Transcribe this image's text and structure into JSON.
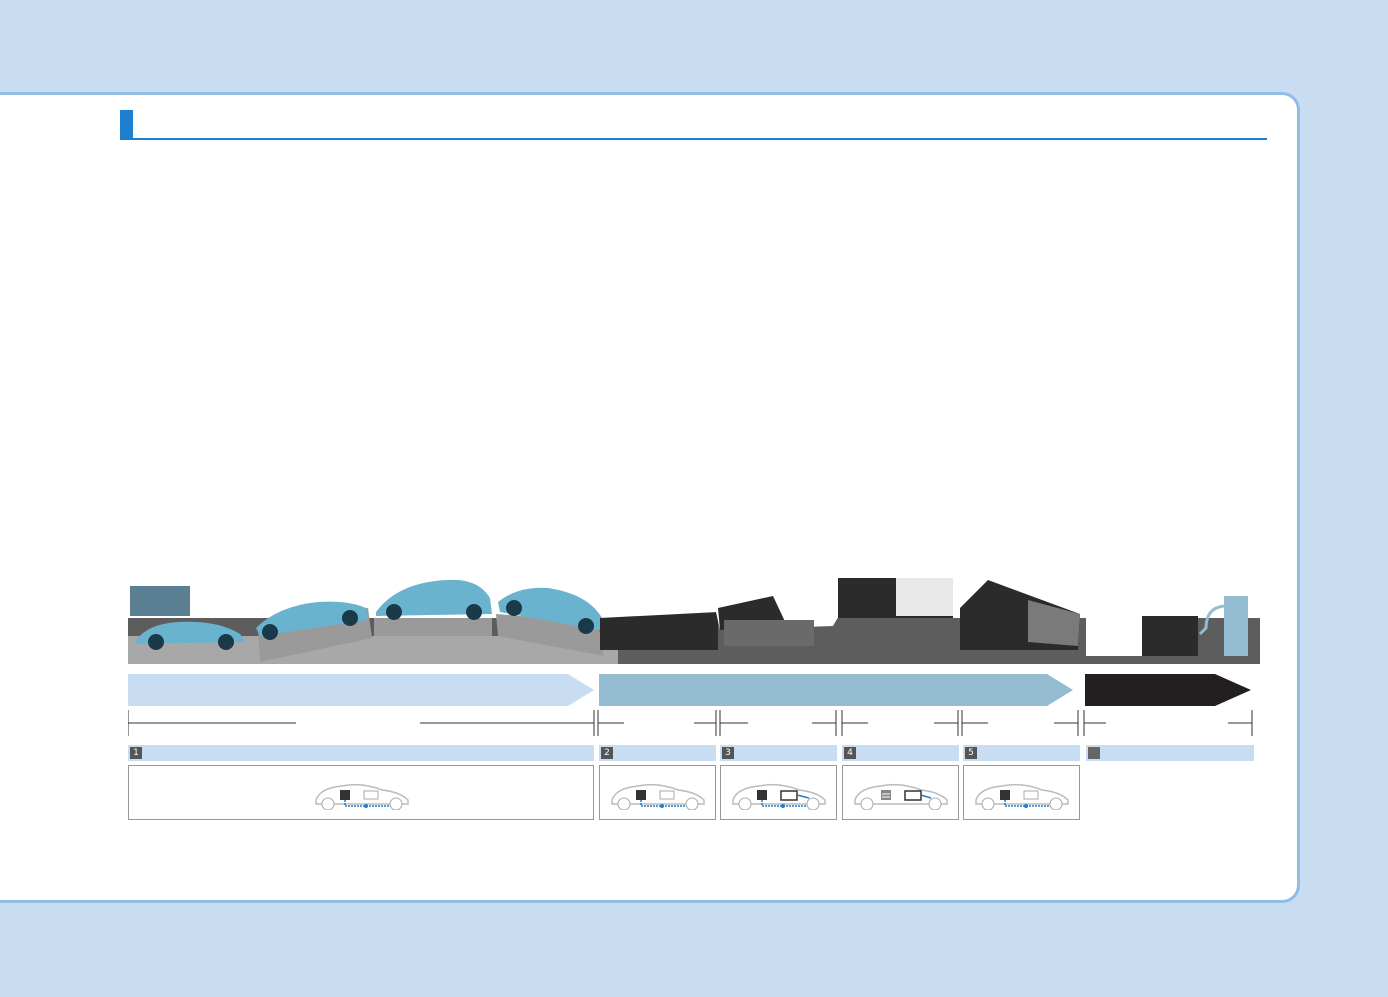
{
  "header": {
    "title": ""
  },
  "colors": {
    "panel_border": "#8fbde6",
    "accent": "#1f7fcf",
    "arrow1": "#c8dcf2",
    "arrow2": "#93bcd1",
    "arrow3": "#231f20",
    "seg_head": "#c8dcf2"
  },
  "arrows": [
    {
      "label": "",
      "color": "#c8dcf2"
    },
    {
      "label": "",
      "color": "#93bcd1"
    },
    {
      "label": "",
      "color": "#231f20"
    }
  ],
  "segments": [
    {
      "num": "1",
      "text": "",
      "icon": "battery-to-wheels-icon"
    },
    {
      "num": "2",
      "text": "",
      "icon": "battery-to-wheels-icon"
    },
    {
      "num": "3",
      "text": "",
      "icon": "battery-engine-to-wheels-icon"
    },
    {
      "num": "4",
      "text": "",
      "icon": "engine-charging-icon"
    },
    {
      "num": "5",
      "text": "",
      "icon": "battery-to-wheels-icon"
    },
    {
      "num": "",
      "text": "",
      "icon": ""
    }
  ]
}
